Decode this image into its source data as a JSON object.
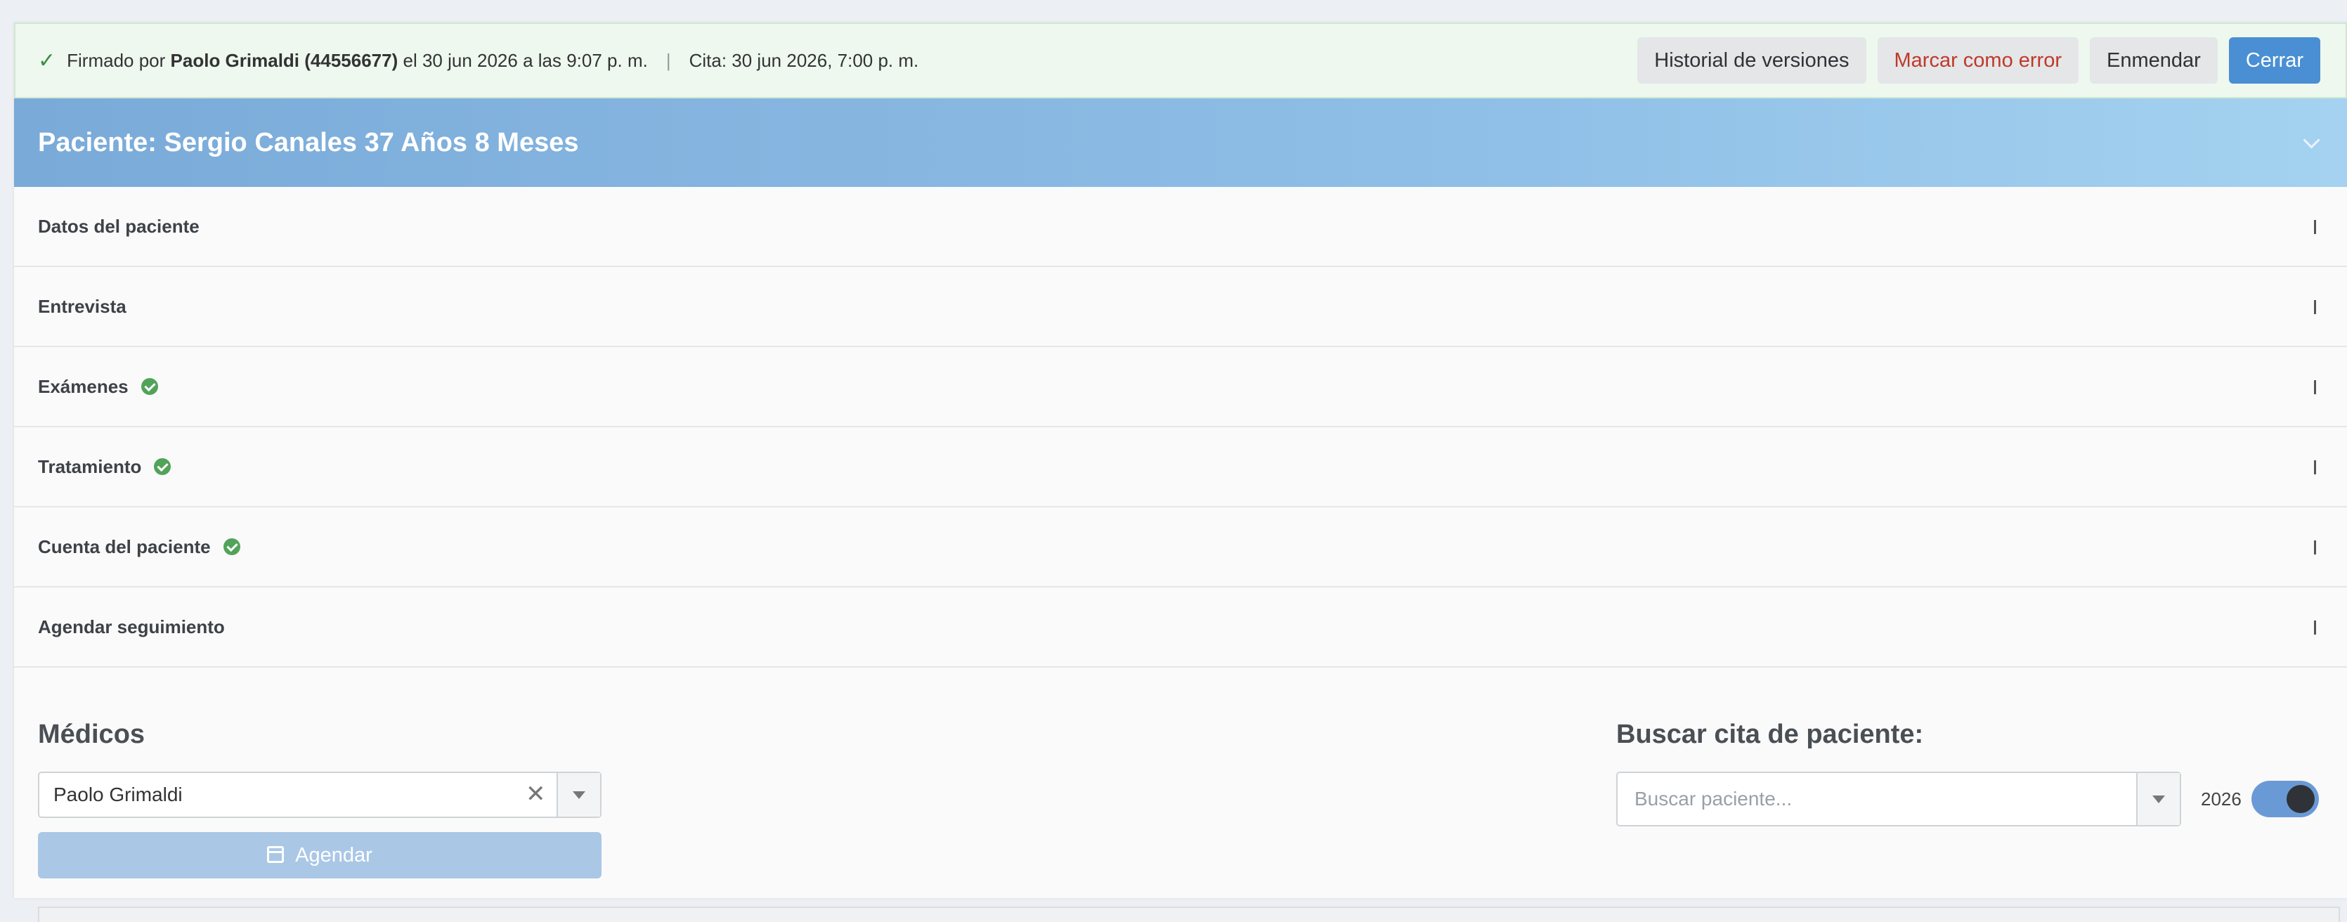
{
  "banner": {
    "check": "✓",
    "signed_prefix": "Firmado por",
    "signer": "Paolo Grimaldi (44556677)",
    "signed_when": "el 30 jun 2026 a las 9:07 p. m.",
    "separator": "|",
    "appointment": "Cita: 30 jun 2026, 7:00 p. m.",
    "actions": {
      "history": "Historial de versiones",
      "mark_error": "Marcar como error",
      "amend": "Enmendar",
      "close": "Cerrar"
    }
  },
  "patient": {
    "title": "Paciente: Sergio Canales 37 Años 8 Meses"
  },
  "sections": [
    {
      "label": "Datos del paciente",
      "complete": false,
      "expanded": false
    },
    {
      "label": "Entrevista",
      "complete": false,
      "expanded": false
    },
    {
      "label": "Exámenes",
      "complete": true,
      "expanded": false
    },
    {
      "label": "Tratamiento",
      "complete": true,
      "expanded": false
    },
    {
      "label": "Cuenta del paciente",
      "complete": true,
      "expanded": false
    },
    {
      "label": "Agendar seguimiento",
      "complete": false,
      "expanded": true
    }
  ],
  "followup": {
    "doctors_title": "Médicos",
    "doctor_selected": "Paolo Grimaldi",
    "clear_glyph": "✕",
    "schedule_button": "Agendar",
    "search_title": "Buscar cita de paciente:",
    "search_placeholder": "Buscar paciente...",
    "year": "2026",
    "year_toggle_on": true
  },
  "colors": {
    "primary": "#4a8fd3",
    "danger": "#c0392b",
    "success": "#52a35a",
    "header_gradient_start": "#7aaad8",
    "header_gradient_end": "#a4d2f0"
  }
}
